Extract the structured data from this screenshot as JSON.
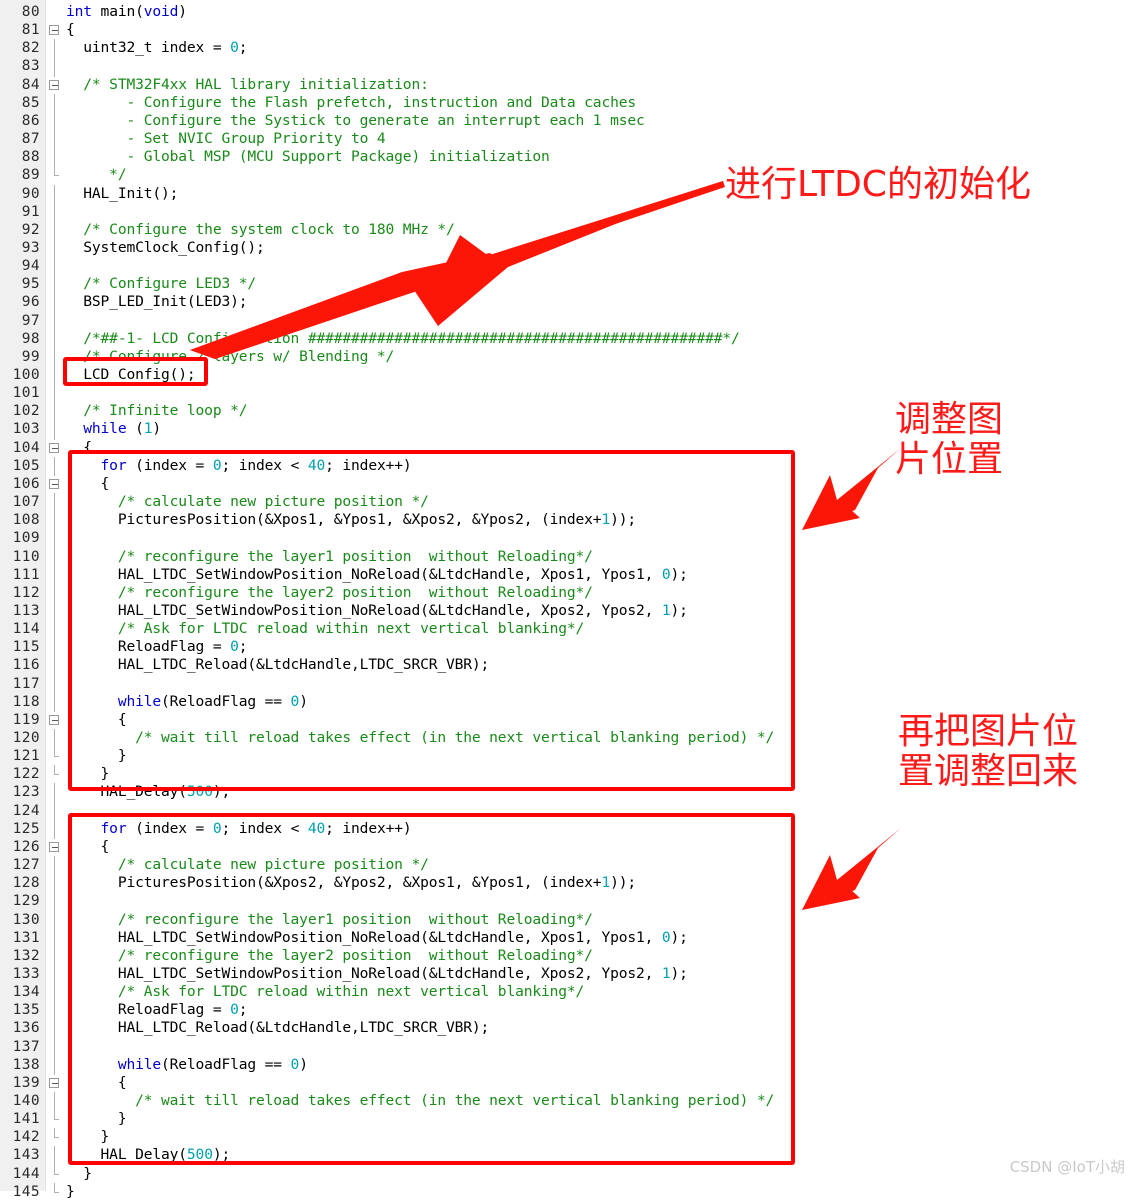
{
  "editor": {
    "first_line": 80,
    "line_height": 18.15,
    "colors": {
      "keyword": "#0000d0",
      "comment": "#1a8a1a",
      "number": "#00a0b0",
      "plain": "#000000",
      "gutter_bg": "#f0f0f0",
      "annotation_red": "#ff0000",
      "watermark": "#c9c9c9"
    },
    "lines": [
      {
        "n": 80,
        "fold": "none",
        "tokens": [
          {
            "t": "kw",
            "s": "int"
          },
          {
            "t": "pl",
            "s": " main("
          },
          {
            "t": "kw",
            "s": "void"
          },
          {
            "t": "pl",
            "s": ")"
          }
        ]
      },
      {
        "n": 81,
        "fold": "open",
        "tokens": [
          {
            "t": "pl",
            "s": "{"
          }
        ]
      },
      {
        "n": 82,
        "fold": "bar",
        "tokens": [
          {
            "t": "pl",
            "s": "  uint32_t index = "
          },
          {
            "t": "num",
            "s": "0"
          },
          {
            "t": "pl",
            "s": ";"
          }
        ]
      },
      {
        "n": 83,
        "fold": "bar",
        "tokens": []
      },
      {
        "n": 84,
        "fold": "open",
        "tokens": [
          {
            "t": "cm",
            "s": "  /* STM32F4xx HAL library initialization:"
          }
        ]
      },
      {
        "n": 85,
        "fold": "bar2",
        "tokens": [
          {
            "t": "cm",
            "s": "       - Configure the Flash prefetch, instruction and Data caches"
          }
        ]
      },
      {
        "n": 86,
        "fold": "bar2",
        "tokens": [
          {
            "t": "cm",
            "s": "       - Configure the Systick to generate an interrupt each 1 msec"
          }
        ]
      },
      {
        "n": 87,
        "fold": "bar2",
        "tokens": [
          {
            "t": "cm",
            "s": "       - Set NVIC Group Priority to 4"
          }
        ]
      },
      {
        "n": 88,
        "fold": "bar2",
        "tokens": [
          {
            "t": "cm",
            "s": "       - Global MSP (MCU Support Package) initialization"
          }
        ]
      },
      {
        "n": 89,
        "fold": "end",
        "tokens": [
          {
            "t": "cm",
            "s": "     */"
          }
        ]
      },
      {
        "n": 90,
        "fold": "bar",
        "tokens": [
          {
            "t": "pl",
            "s": "  HAL_Init();"
          }
        ]
      },
      {
        "n": 91,
        "fold": "bar",
        "tokens": []
      },
      {
        "n": 92,
        "fold": "bar",
        "tokens": [
          {
            "t": "cm",
            "s": "  /* Configure the system clock to 180 MHz */"
          }
        ]
      },
      {
        "n": 93,
        "fold": "bar",
        "tokens": [
          {
            "t": "pl",
            "s": "  SystemClock_Config();"
          }
        ]
      },
      {
        "n": 94,
        "fold": "bar",
        "tokens": []
      },
      {
        "n": 95,
        "fold": "bar",
        "tokens": [
          {
            "t": "cm",
            "s": "  /* Configure LED3 */"
          }
        ]
      },
      {
        "n": 96,
        "fold": "bar",
        "tokens": [
          {
            "t": "pl",
            "s": "  BSP_LED_Init(LED3);"
          }
        ]
      },
      {
        "n": 97,
        "fold": "bar",
        "tokens": []
      },
      {
        "n": 98,
        "fold": "bar",
        "tokens": [
          {
            "t": "cm",
            "s": "  /*##-1- LCD Configuration ################################################*/"
          }
        ]
      },
      {
        "n": 99,
        "fold": "bar",
        "tokens": [
          {
            "t": "cm",
            "s": "  /* Configure 2 layers w/ Blending */"
          }
        ]
      },
      {
        "n": 100,
        "fold": "bar",
        "tokens": [
          {
            "t": "pl",
            "s": "  LCD_Config();"
          }
        ]
      },
      {
        "n": 101,
        "fold": "bar",
        "tokens": []
      },
      {
        "n": 102,
        "fold": "bar",
        "tokens": [
          {
            "t": "cm",
            "s": "  /* Infinite loop */"
          }
        ]
      },
      {
        "n": 103,
        "fold": "bar",
        "tokens": [
          {
            "t": "kw",
            "s": "  while"
          },
          {
            "t": "pl",
            "s": " ("
          },
          {
            "t": "num",
            "s": "1"
          },
          {
            "t": "pl",
            "s": ")"
          }
        ]
      },
      {
        "n": 104,
        "fold": "open",
        "tokens": [
          {
            "t": "pl",
            "s": "  {"
          }
        ]
      },
      {
        "n": 105,
        "fold": "bar",
        "tokens": [
          {
            "t": "kw",
            "s": "    for"
          },
          {
            "t": "pl",
            "s": " (index = "
          },
          {
            "t": "num",
            "s": "0"
          },
          {
            "t": "pl",
            "s": "; index < "
          },
          {
            "t": "num",
            "s": "40"
          },
          {
            "t": "pl",
            "s": "; index++)"
          }
        ]
      },
      {
        "n": 106,
        "fold": "open",
        "tokens": [
          {
            "t": "pl",
            "s": "    {"
          }
        ]
      },
      {
        "n": 107,
        "fold": "bar",
        "tokens": [
          {
            "t": "cm",
            "s": "      /* calculate new picture position */"
          }
        ]
      },
      {
        "n": 108,
        "fold": "bar",
        "tokens": [
          {
            "t": "pl",
            "s": "      PicturesPosition(&Xpos1, &Ypos1, &Xpos2, &Ypos2, (index+"
          },
          {
            "t": "num",
            "s": "1"
          },
          {
            "t": "pl",
            "s": "));"
          }
        ]
      },
      {
        "n": 109,
        "fold": "bar",
        "tokens": []
      },
      {
        "n": 110,
        "fold": "bar",
        "tokens": [
          {
            "t": "cm",
            "s": "      /* reconfigure the layer1 position  without Reloading*/"
          }
        ]
      },
      {
        "n": 111,
        "fold": "bar",
        "tokens": [
          {
            "t": "pl",
            "s": "      HAL_LTDC_SetWindowPosition_NoReload(&LtdcHandle, Xpos1, Ypos1, "
          },
          {
            "t": "num",
            "s": "0"
          },
          {
            "t": "pl",
            "s": ");"
          }
        ]
      },
      {
        "n": 112,
        "fold": "bar",
        "tokens": [
          {
            "t": "cm",
            "s": "      /* reconfigure the layer2 position  without Reloading*/"
          }
        ]
      },
      {
        "n": 113,
        "fold": "bar",
        "tokens": [
          {
            "t": "pl",
            "s": "      HAL_LTDC_SetWindowPosition_NoReload(&LtdcHandle, Xpos2, Ypos2, "
          },
          {
            "t": "num",
            "s": "1"
          },
          {
            "t": "pl",
            "s": ");"
          }
        ]
      },
      {
        "n": 114,
        "fold": "bar",
        "tokens": [
          {
            "t": "cm",
            "s": "      /* Ask for LTDC reload within next vertical blanking*/"
          }
        ]
      },
      {
        "n": 115,
        "fold": "bar",
        "tokens": [
          {
            "t": "pl",
            "s": "      ReloadFlag = "
          },
          {
            "t": "num",
            "s": "0"
          },
          {
            "t": "pl",
            "s": ";"
          }
        ]
      },
      {
        "n": 116,
        "fold": "bar",
        "tokens": [
          {
            "t": "pl",
            "s": "      HAL_LTDC_Reload(&LtdcHandle,LTDC_SRCR_VBR);"
          }
        ]
      },
      {
        "n": 117,
        "fold": "bar",
        "tokens": []
      },
      {
        "n": 118,
        "fold": "bar",
        "tokens": [
          {
            "t": "kw",
            "s": "      while"
          },
          {
            "t": "pl",
            "s": "(ReloadFlag == "
          },
          {
            "t": "num",
            "s": "0"
          },
          {
            "t": "pl",
            "s": ")"
          }
        ]
      },
      {
        "n": 119,
        "fold": "open",
        "tokens": [
          {
            "t": "pl",
            "s": "      {"
          }
        ]
      },
      {
        "n": 120,
        "fold": "bar2",
        "tokens": [
          {
            "t": "cm",
            "s": "        /* wait till reload takes effect (in the next vertical blanking period) */"
          }
        ]
      },
      {
        "n": 121,
        "fold": "end",
        "tokens": [
          {
            "t": "pl",
            "s": "      }"
          }
        ]
      },
      {
        "n": 122,
        "fold": "end",
        "tokens": [
          {
            "t": "pl",
            "s": "    }"
          }
        ]
      },
      {
        "n": 123,
        "fold": "bar",
        "tokens": [
          {
            "t": "pl",
            "s": "    HAL_Delay("
          },
          {
            "t": "num",
            "s": "500"
          },
          {
            "t": "pl",
            "s": ");"
          }
        ]
      },
      {
        "n": 124,
        "fold": "bar",
        "tokens": []
      },
      {
        "n": 125,
        "fold": "bar",
        "tokens": [
          {
            "t": "kw",
            "s": "    for"
          },
          {
            "t": "pl",
            "s": " (index = "
          },
          {
            "t": "num",
            "s": "0"
          },
          {
            "t": "pl",
            "s": "; index < "
          },
          {
            "t": "num",
            "s": "40"
          },
          {
            "t": "pl",
            "s": "; index++)"
          }
        ]
      },
      {
        "n": 126,
        "fold": "open",
        "tokens": [
          {
            "t": "pl",
            "s": "    {"
          }
        ]
      },
      {
        "n": 127,
        "fold": "bar",
        "tokens": [
          {
            "t": "cm",
            "s": "      /* calculate new picture position */"
          }
        ]
      },
      {
        "n": 128,
        "fold": "bar",
        "tokens": [
          {
            "t": "pl",
            "s": "      PicturesPosition(&Xpos2, &Ypos2, &Xpos1, &Ypos1, (index+"
          },
          {
            "t": "num",
            "s": "1"
          },
          {
            "t": "pl",
            "s": "));"
          }
        ]
      },
      {
        "n": 129,
        "fold": "bar",
        "tokens": []
      },
      {
        "n": 130,
        "fold": "bar",
        "tokens": [
          {
            "t": "cm",
            "s": "      /* reconfigure the layer1 position  without Reloading*/"
          }
        ]
      },
      {
        "n": 131,
        "fold": "bar",
        "tokens": [
          {
            "t": "pl",
            "s": "      HAL_LTDC_SetWindowPosition_NoReload(&LtdcHandle, Xpos1, Ypos1, "
          },
          {
            "t": "num",
            "s": "0"
          },
          {
            "t": "pl",
            "s": ");"
          }
        ]
      },
      {
        "n": 132,
        "fold": "bar",
        "tokens": [
          {
            "t": "cm",
            "s": "      /* reconfigure the layer2 position  without Reloading*/"
          }
        ]
      },
      {
        "n": 133,
        "fold": "bar",
        "tokens": [
          {
            "t": "pl",
            "s": "      HAL_LTDC_SetWindowPosition_NoReload(&LtdcHandle, Xpos2, Ypos2, "
          },
          {
            "t": "num",
            "s": "1"
          },
          {
            "t": "pl",
            "s": ");"
          }
        ]
      },
      {
        "n": 134,
        "fold": "bar",
        "tokens": [
          {
            "t": "cm",
            "s": "      /* Ask for LTDC reload within next vertical blanking*/"
          }
        ]
      },
      {
        "n": 135,
        "fold": "bar",
        "tokens": [
          {
            "t": "pl",
            "s": "      ReloadFlag = "
          },
          {
            "t": "num",
            "s": "0"
          },
          {
            "t": "pl",
            "s": ";"
          }
        ]
      },
      {
        "n": 136,
        "fold": "bar",
        "tokens": [
          {
            "t": "pl",
            "s": "      HAL_LTDC_Reload(&LtdcHandle,LTDC_SRCR_VBR);"
          }
        ]
      },
      {
        "n": 137,
        "fold": "bar",
        "tokens": []
      },
      {
        "n": 138,
        "fold": "bar",
        "tokens": [
          {
            "t": "kw",
            "s": "      while"
          },
          {
            "t": "pl",
            "s": "(ReloadFlag == "
          },
          {
            "t": "num",
            "s": "0"
          },
          {
            "t": "pl",
            "s": ")"
          }
        ]
      },
      {
        "n": 139,
        "fold": "open",
        "tokens": [
          {
            "t": "pl",
            "s": "      {"
          }
        ]
      },
      {
        "n": 140,
        "fold": "bar2",
        "tokens": [
          {
            "t": "cm",
            "s": "        /* wait till reload takes effect (in the next vertical blanking period) */"
          }
        ]
      },
      {
        "n": 141,
        "fold": "end",
        "tokens": [
          {
            "t": "pl",
            "s": "      }"
          }
        ]
      },
      {
        "n": 142,
        "fold": "end",
        "tokens": [
          {
            "t": "pl",
            "s": "    }"
          }
        ]
      },
      {
        "n": 143,
        "fold": "bar",
        "tokens": [
          {
            "t": "pl",
            "s": "    HAL_Delay("
          },
          {
            "t": "num",
            "s": "500"
          },
          {
            "t": "pl",
            "s": ");"
          }
        ]
      },
      {
        "n": 144,
        "fold": "end",
        "tokens": [
          {
            "t": "pl",
            "s": "  }"
          }
        ]
      },
      {
        "n": 145,
        "fold": "end",
        "tokens": [
          {
            "t": "pl",
            "s": "}"
          }
        ]
      }
    ]
  },
  "annotations": {
    "note_ltdc_init": "进行LTDC的初始化",
    "note_adjust_position": "调整图\n片位置",
    "note_restore_position": "再把图片位\n置调整回来",
    "boxes": [
      {
        "name": "lcd-config-highlight"
      },
      {
        "name": "first-for-loop-highlight"
      },
      {
        "name": "second-for-loop-highlight"
      }
    ]
  },
  "watermark": {
    "text": "CSDN @IoT小胡"
  }
}
